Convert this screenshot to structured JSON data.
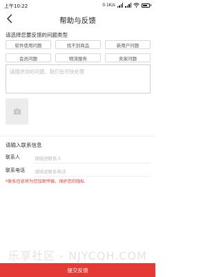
{
  "status_bar": {
    "time": "上午10:22",
    "network_speed": "0.1K/s"
  },
  "header": {
    "title": "帮助与反馈",
    "back_icon": "chevron-left-icon"
  },
  "feedback_type": {
    "heading": "请选择您要反馈的问题类型",
    "options": [
      "软件使用问题",
      "找不到商品",
      "新用户问题",
      "会员问题",
      "物流服务",
      "卖家问题"
    ]
  },
  "description": {
    "placeholder": "请描述你的问题，我们会尽快处理"
  },
  "upload": {
    "icon": "camera-icon"
  },
  "contact": {
    "heading": "请输入联系信息",
    "fields": [
      {
        "label": "联系人",
        "placeholder": "请描述联系人"
      },
      {
        "label": "联系电话",
        "placeholder": "请描述联系电话"
      }
    ],
    "notice": "*联系信息将为您加密传输，保护您的隐私"
  },
  "watermark": "乐享社区 - NJYCQH.COM",
  "submit": {
    "label": "提交反馈"
  },
  "colors": {
    "accent": "#e53935",
    "border": "#d6d6d6",
    "placeholder": "#bcbcbc"
  }
}
